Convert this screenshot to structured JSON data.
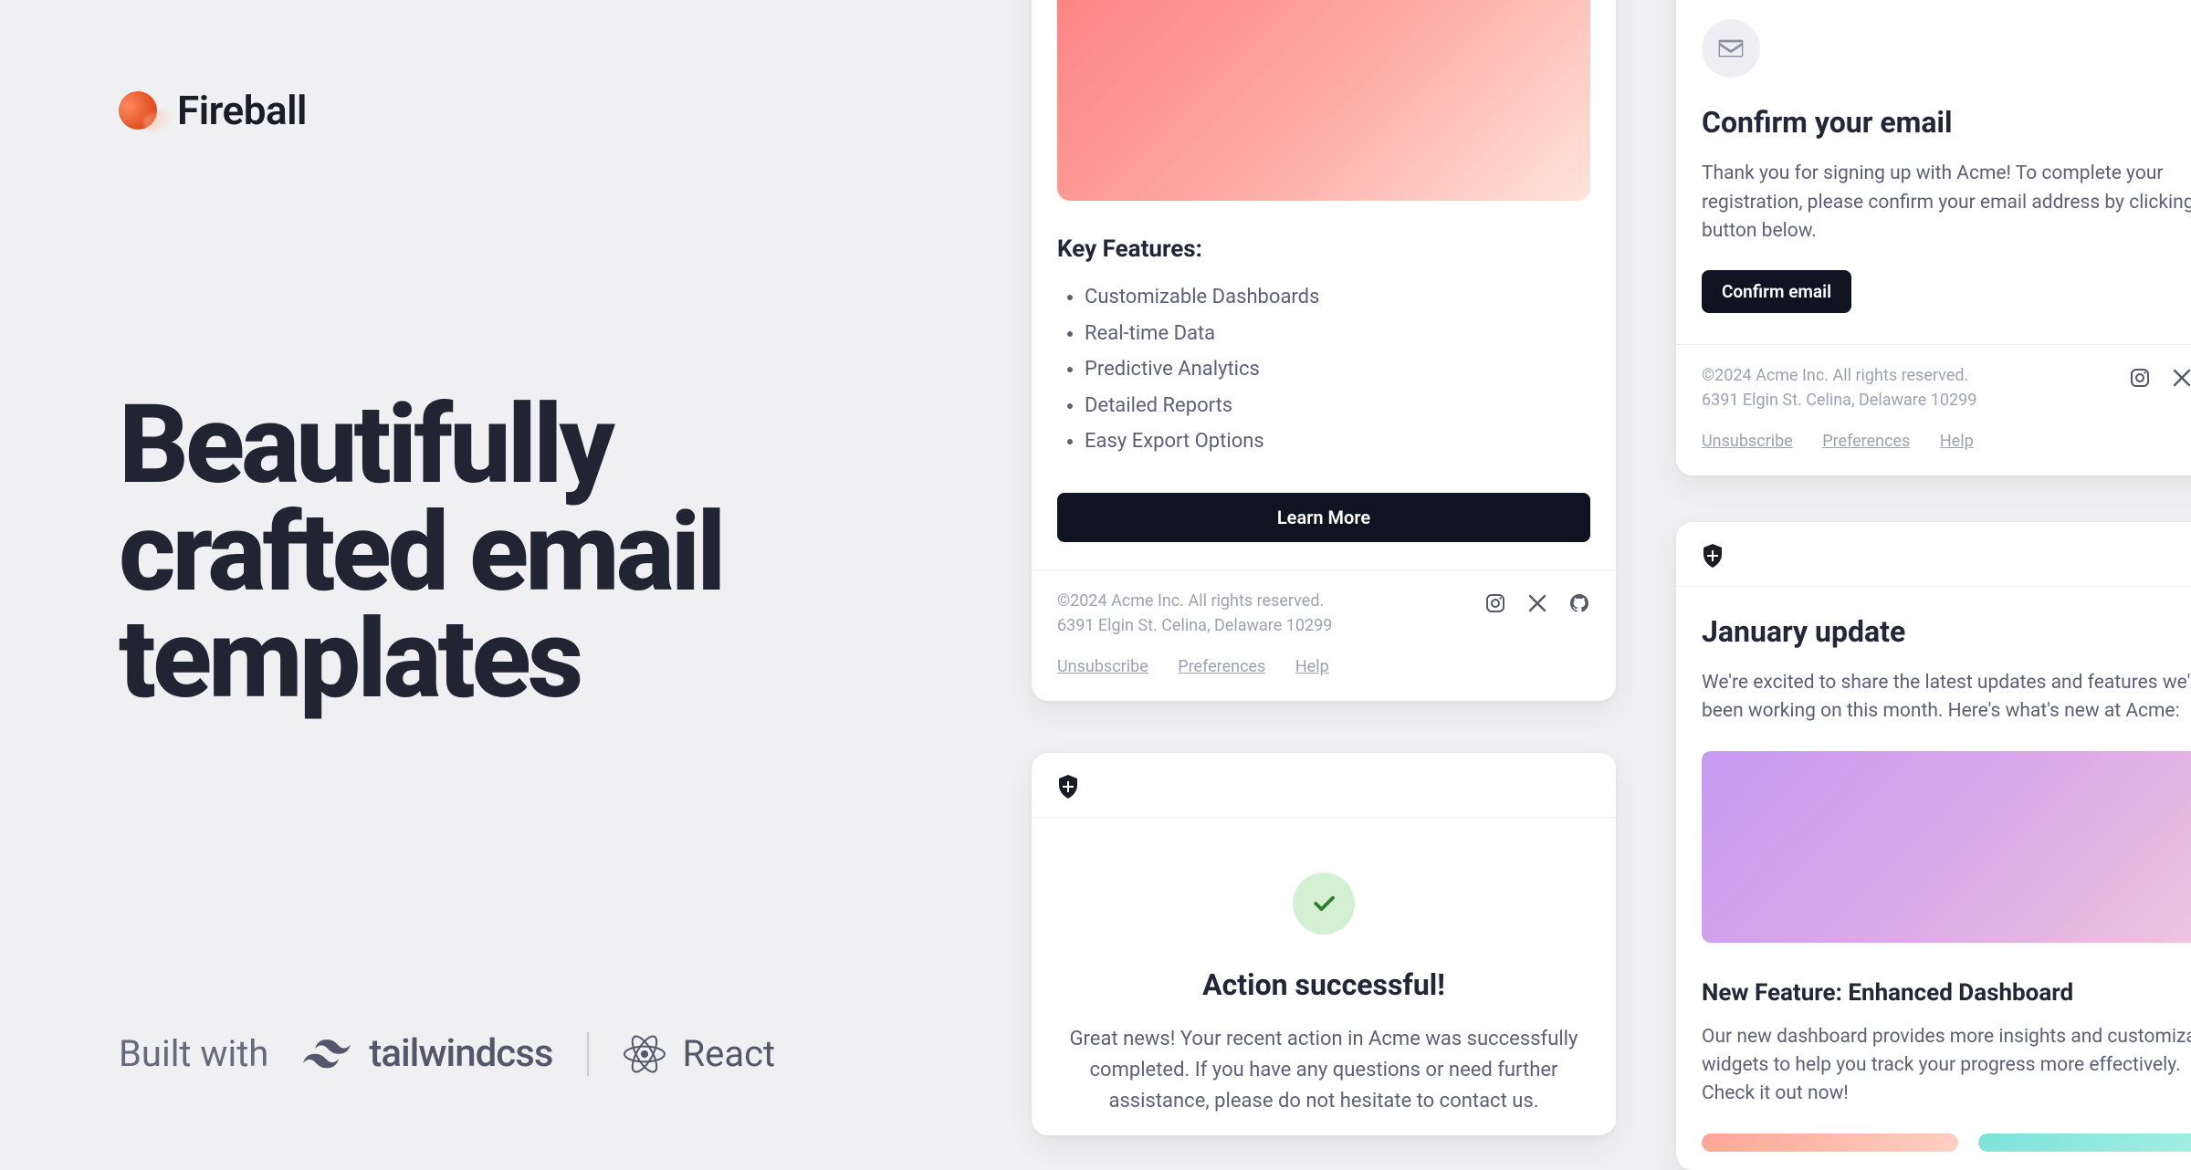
{
  "brand": {
    "name": "Fireball"
  },
  "hero": {
    "title_line1": "Beautifully",
    "title_line2": "crafted email",
    "title_line3": "templates",
    "built_with_label": "Built with",
    "tech1": "tailwindcss",
    "tech2": "React"
  },
  "card_features": {
    "heading": "Key Features:",
    "items": [
      "Customizable Dashboards",
      "Real-time Data",
      "Predictive Analytics",
      "Detailed Reports",
      "Easy Export Options"
    ],
    "button": "Learn More"
  },
  "card_success": {
    "title": "Action successful!",
    "body": "Great news! Your recent action in Acme was successfully completed. If you have any questions or need further assistance, please do not hesitate to contact us."
  },
  "card_confirm": {
    "title": "Confirm your email",
    "body": "Thank you for signing up with Acme! To complete your registration, please confirm your email address by clicking the button below.",
    "button": "Confirm email"
  },
  "card_update": {
    "title": "January update",
    "intro": "We're excited to share the latest updates and features we've been working on this month. Here's what's new at Acme:",
    "feature_title": "New Feature: Enhanced Dashboard",
    "feature_body": "Our new dashboard provides more insights and customizable widgets to help you track your progress more effectively. Check it out now!"
  },
  "footer": {
    "copyright": "©2024 Acme Inc. All rights reserved.",
    "address": "6391 Elgin St. Celina, Delaware 10299",
    "links": {
      "unsubscribe": "Unsubscribe",
      "preferences": "Preferences",
      "help": "Help"
    }
  }
}
